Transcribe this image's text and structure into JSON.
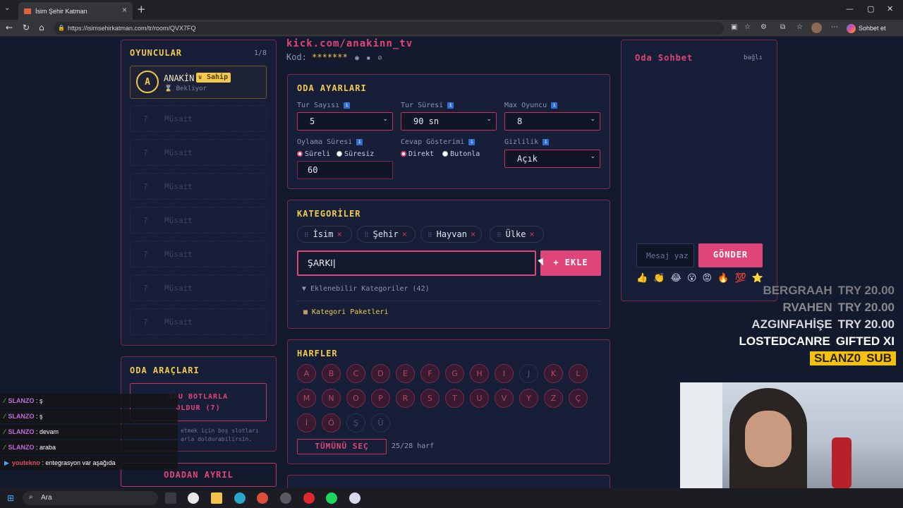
{
  "browser": {
    "tab_title": "İsim Şehir Katman",
    "url": "https://isimsehirkatman.com/tr/room/QVX7FQ",
    "profile_button": "Sohbet et"
  },
  "room": {
    "stream_link": "kick.com/anakinn_tv",
    "code_label": "Kod:",
    "code_value": "*******"
  },
  "players": {
    "title": "OYUNCULAR",
    "count": "1/8",
    "host": {
      "initial": "A",
      "name": "ANAKİN",
      "badge": "Sahip",
      "status": "Bekliyor"
    },
    "empty_slots": [
      {
        "q": "?",
        "label": "Müsait"
      },
      {
        "q": "?",
        "label": "Müsait"
      },
      {
        "q": "?",
        "label": "Müsait"
      },
      {
        "q": "?",
        "label": "Müsait"
      },
      {
        "q": "?",
        "label": "Müsait"
      },
      {
        "q": "?",
        "label": "Müsait"
      },
      {
        "q": "?",
        "label": "Müsait"
      }
    ]
  },
  "tools": {
    "title": "ODA ARAÇLARI",
    "bot_button_l1": "NAU BOTLARLA",
    "bot_button_l2": "OLDUR (7)",
    "help_l1": "etmek için boş slotları",
    "help_l2": "arla doldurabilirsin.",
    "leave_button": "ODADAN AYRIL"
  },
  "settings": {
    "title": "ODA AYARLARI",
    "rounds_label": "Tur Sayısı",
    "rounds_value": "5",
    "duration_label": "Tur Süresi",
    "duration_value": "90 sn",
    "max_label": "Max Oyuncu",
    "max_value": "8",
    "vote_label": "Oylama Süresi",
    "vote_opt1": "Süreli",
    "vote_opt2": "Süresiz",
    "vote_value": "60",
    "answer_label": "Cevap Gösterimi",
    "answer_opt1": "Direkt",
    "answer_opt2": "Butonla",
    "privacy_label": "Gizlilik",
    "privacy_value": "Açık"
  },
  "categories": {
    "title": "KATEGORİLER",
    "chips": [
      "İsim",
      "Şehir",
      "Hayvan",
      "Ülke"
    ],
    "input_value": "ŞARKI",
    "add_button": "+ EKLE",
    "available": "▼ Eklenebilir Kategoriler (42)",
    "packages": "Kategori Paketleri"
  },
  "letters": {
    "title": "HARFLER",
    "row1": [
      {
        "c": "A",
        "on": true
      },
      {
        "c": "B",
        "on": true
      },
      {
        "c": "C",
        "on": true
      },
      {
        "c": "D",
        "on": true
      },
      {
        "c": "E",
        "on": true
      },
      {
        "c": "F",
        "on": true
      },
      {
        "c": "G",
        "on": true
      },
      {
        "c": "H",
        "on": true
      },
      {
        "c": "I",
        "on": true
      },
      {
        "c": "J",
        "on": false
      },
      {
        "c": "K",
        "on": true
      },
      {
        "c": "L",
        "on": true
      }
    ],
    "row2": [
      {
        "c": "M",
        "on": true
      },
      {
        "c": "N",
        "on": true
      },
      {
        "c": "O",
        "on": true
      },
      {
        "c": "P",
        "on": true
      },
      {
        "c": "R",
        "on": true
      },
      {
        "c": "S",
        "on": true
      },
      {
        "c": "T",
        "on": true
      },
      {
        "c": "U",
        "on": true
      },
      {
        "c": "V",
        "on": true
      },
      {
        "c": "Y",
        "on": true
      },
      {
        "c": "Z",
        "on": true
      },
      {
        "c": "Ç",
        "on": true
      }
    ],
    "row3": [
      {
        "c": "İ",
        "on": true
      },
      {
        "c": "Ö",
        "on": true
      },
      {
        "c": "Ş",
        "on": false
      },
      {
        "c": "Ü",
        "on": false
      }
    ],
    "select_all": "TÜMÜNÜ SEÇ",
    "count": "25/28 harf"
  },
  "chat": {
    "title": "Oda Sohbet",
    "status": "bağlı",
    "placeholder": "Mesaj yaz",
    "send": "GÖNDER",
    "emojis": [
      "👍",
      "👏",
      "😂",
      "😮",
      "😡",
      "🔥",
      "💯",
      "⭐"
    ]
  },
  "stream_alerts": [
    {
      "name": "BERGRAAH",
      "detail": "TRY 20.00",
      "color": "#7c7c80"
    },
    {
      "name": "RVAHEN",
      "detail": "TRY 20.00",
      "color": "#8a8a8e"
    },
    {
      "name": "AZGINFAHİŞE",
      "detail": "TRY 20.00",
      "color": "#d8d8dc"
    },
    {
      "name": "LOSTEDCANRE",
      "detail": "GIFTED XI",
      "color": "#ffffff"
    },
    {
      "name": "SLANZ0",
      "detail": "SUB",
      "color": "#2a2000"
    }
  ],
  "stream_chat": [
    {
      "user": "SLANZO",
      "msg": "ş"
    },
    {
      "user": "SLANZO",
      "msg": "ş"
    },
    {
      "user": "SLANZO",
      "msg": "devam"
    },
    {
      "user": "SLANZO",
      "msg": "araba"
    },
    {
      "user": "youtekno",
      "msg": "entegrasyon var aşağıda"
    }
  ],
  "taskbar": {
    "search": "Ara"
  }
}
